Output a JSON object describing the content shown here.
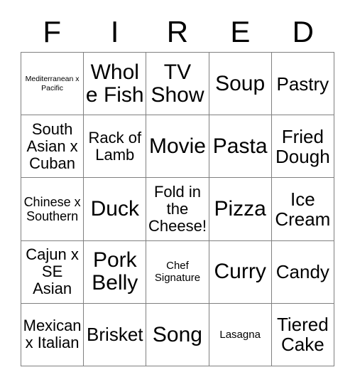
{
  "card": {
    "header_letters": [
      "F",
      "I",
      "R",
      "E",
      "D"
    ],
    "columns": 5,
    "rows": 5,
    "grid_line_color": "#808080",
    "background_color": "#ffffff",
    "text_color": "#000000",
    "cells": [
      [
        {
          "text": "Mediterranean x Pacific",
          "size": "xs"
        },
        {
          "text": "Whole Fish",
          "size": "xxl"
        },
        {
          "text": "TV Show",
          "size": "xxl"
        },
        {
          "text": "Soup",
          "size": "xxl"
        },
        {
          "text": "Pastry",
          "size": "xl"
        }
      ],
      [
        {
          "text": "South Asian x Cuban",
          "size": "lg"
        },
        {
          "text": "Rack of Lamb",
          "size": "lg"
        },
        {
          "text": "Movie",
          "size": "xxl"
        },
        {
          "text": "Pasta",
          "size": "xxl"
        },
        {
          "text": "Fried Dough",
          "size": "xl"
        }
      ],
      [
        {
          "text": "Chinese x Southern",
          "size": "md"
        },
        {
          "text": "Duck",
          "size": "xxl"
        },
        {
          "text": "Fold in the Cheese!",
          "size": "lg"
        },
        {
          "text": "Pizza",
          "size": "xxl"
        },
        {
          "text": "Ice Cream",
          "size": "xl"
        }
      ],
      [
        {
          "text": "Cajun x SE Asian",
          "size": "lg"
        },
        {
          "text": "Pork Belly",
          "size": "xxl"
        },
        {
          "text": "Chef Signature",
          "size": "sm"
        },
        {
          "text": "Curry",
          "size": "xxl"
        },
        {
          "text": "Candy",
          "size": "xl"
        }
      ],
      [
        {
          "text": "Mexican x Italian",
          "size": "lg"
        },
        {
          "text": "Brisket",
          "size": "xl"
        },
        {
          "text": "Song",
          "size": "xxl"
        },
        {
          "text": "Lasagna",
          "size": "sm"
        },
        {
          "text": "Tiered Cake",
          "size": "xl"
        }
      ]
    ]
  }
}
